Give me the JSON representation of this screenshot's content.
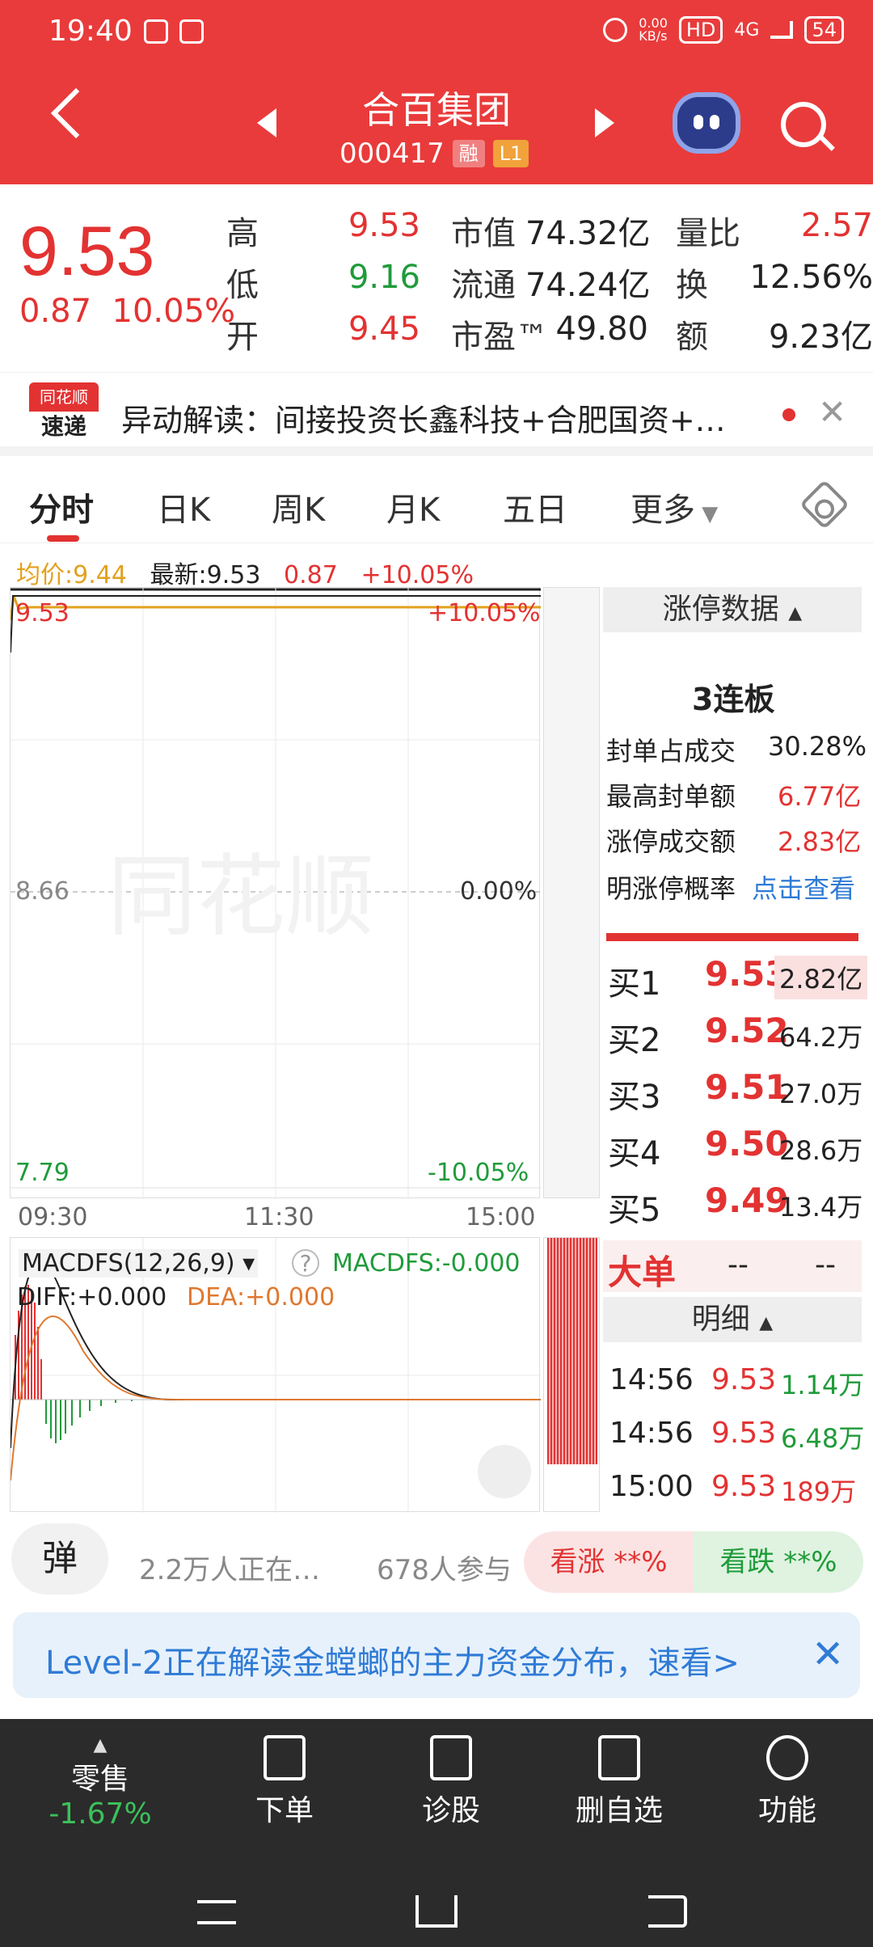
{
  "status": {
    "time": "19:40",
    "net_speed": "0.00\nKB/s",
    "hd": "HD",
    "signal": "4G",
    "battery": "54"
  },
  "header": {
    "title": "合百集团",
    "code": "000417",
    "tag_rong": "融",
    "tag_level": "L1"
  },
  "quote": {
    "price": "9.53",
    "change": "0.87",
    "change_pct": "10.05%",
    "high_label": "高",
    "high": "9.53",
    "low_label": "低",
    "low": "9.16",
    "open_label": "开",
    "open": "9.45",
    "mktcap_label": "市值",
    "mktcap": "74.32亿",
    "float_label": "流通",
    "float": "74.24亿",
    "pe_label": "市盈™",
    "pe": "49.80",
    "vol_ratio_label": "量比",
    "vol_ratio": "2.57",
    "turnover_label": "换",
    "turnover": "12.56%",
    "amount_label": "额",
    "amount": "9.23亿"
  },
  "news": {
    "logo_top": "同花顺",
    "logo_bottom": "速递",
    "text": "异动解读：间接投资长鑫科技+合肥国资+…"
  },
  "tabs": [
    "分时",
    "日K",
    "周K",
    "月K",
    "五日",
    "更多"
  ],
  "info": {
    "avg_label": "均价:",
    "avg": "9.44",
    "latest_label": "最新:",
    "latest": "9.53",
    "chg": "0.87",
    "pct": "+10.05%"
  },
  "chart": {
    "y_top": "9.53",
    "y_mid": "8.66",
    "y_bot": "7.79",
    "pct_top": "+10.05%",
    "pct_mid": "0.00%",
    "pct_bot": "-10.05%",
    "x_labels": [
      "09:30",
      "11:30",
      "15:00"
    ],
    "macd_title": "MACDFS(12,26,9)",
    "macd_value": "MACDFS:-0.000",
    "diff": "DIFF:+0.000",
    "dea": "DEA:+0.000",
    "watermark": "同花顺"
  },
  "limit": {
    "title": "涨停数据",
    "streak": "3连板",
    "items": [
      {
        "label": "封单占成交",
        "value": "30.28%"
      },
      {
        "label": "最高封单额",
        "value": "6.77亿"
      },
      {
        "label": "涨停成交额",
        "value": "2.83亿"
      },
      {
        "label": "明涨停概率",
        "value": "点击查看"
      }
    ]
  },
  "bids": [
    {
      "label": "买1",
      "price": "9.53",
      "vol": "2.82亿"
    },
    {
      "label": "买2",
      "price": "9.52",
      "vol": "64.2万"
    },
    {
      "label": "买3",
      "price": "9.51",
      "vol": "27.0万"
    },
    {
      "label": "买4",
      "price": "9.50",
      "vol": "28.6万"
    },
    {
      "label": "买5",
      "price": "9.49",
      "vol": "13.4万"
    }
  ],
  "bigorder": {
    "label": "大单",
    "v1": "--",
    "v2": "--"
  },
  "detail": {
    "title": "明细",
    "rows": [
      {
        "time": "14:56",
        "price": "9.53",
        "vol": "1.14万"
      },
      {
        "time": "14:56",
        "price": "9.53",
        "vol": "6.48万"
      },
      {
        "time": "15:00",
        "price": "9.53",
        "vol": "189万"
      }
    ]
  },
  "vote": {
    "dan": "弹",
    "watching": "2.2万人正在…",
    "join": "678人参与",
    "up": "看涨 **%",
    "down": "看跌 **%"
  },
  "level2": {
    "text": "Level-2正在解读金螳螂的主力资金分布，速看>"
  },
  "nav": {
    "retail_label": "零售",
    "retail_pct": "-1.67%",
    "items": [
      "下单",
      "诊股",
      "删自选",
      "功能"
    ]
  },
  "colors": {
    "brand": "#e93b3b",
    "up": "#e33232",
    "down": "#1f9b3a",
    "avg_line": "#e2a11e"
  }
}
